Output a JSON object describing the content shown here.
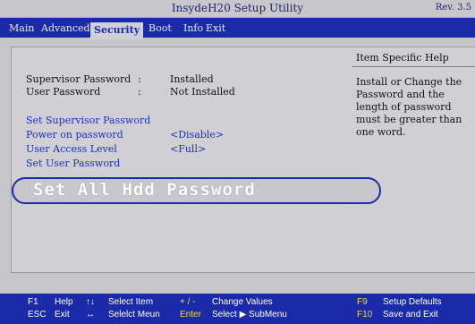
{
  "title": {
    "text": "InsydeH20 Setup Utility",
    "rev": "Rev. 3.5"
  },
  "menu": {
    "items": [
      {
        "label": "Main"
      },
      {
        "label": "Advanced"
      },
      {
        "label": "Security"
      },
      {
        "label": "Boot"
      },
      {
        "label": "Info"
      },
      {
        "label": "Exit"
      }
    ],
    "active": "Security"
  },
  "status": {
    "supervisor": {
      "label": "Supervisor Password",
      "value": "Installed"
    },
    "user": {
      "label": "User Password",
      "value": "Not Installed"
    },
    "colon": ":"
  },
  "options": {
    "set_supervisor": "Set Supervisor Password",
    "power_on": {
      "label": "Power on password",
      "value": "<Disable>"
    },
    "user_access": {
      "label": "User Access Level",
      "value": "<Full>"
    },
    "set_user": "Set User Password",
    "set_hdd": "Set All Hdd Password"
  },
  "help": {
    "title": "Item Specific Help",
    "text": "Install or Change the Password and the length of password must be greater than one word."
  },
  "footer": {
    "f1": {
      "key": "F1",
      "label": "Help"
    },
    "esc": {
      "key": "ESC",
      "label": "Exit"
    },
    "updown": {
      "key": "↑↓",
      "label": "Select Item"
    },
    "leftright": {
      "key": "↔",
      "label": "Selelct Meun"
    },
    "plusminus": {
      "key": "+ / -",
      "label": "Change Values"
    },
    "enter": {
      "key": "Enter",
      "label": "Select ▶ SubMenu"
    },
    "f9": {
      "key": "F9",
      "label": "Setup Defaults"
    },
    "f10": {
      "key": "F10",
      "label": "Save and Exit"
    }
  },
  "colors": {
    "menu_bar": "#1b2aa8",
    "option_text": "#1c2fbe",
    "footer_key": "#f0d84a",
    "background": "#c6c6ca"
  }
}
